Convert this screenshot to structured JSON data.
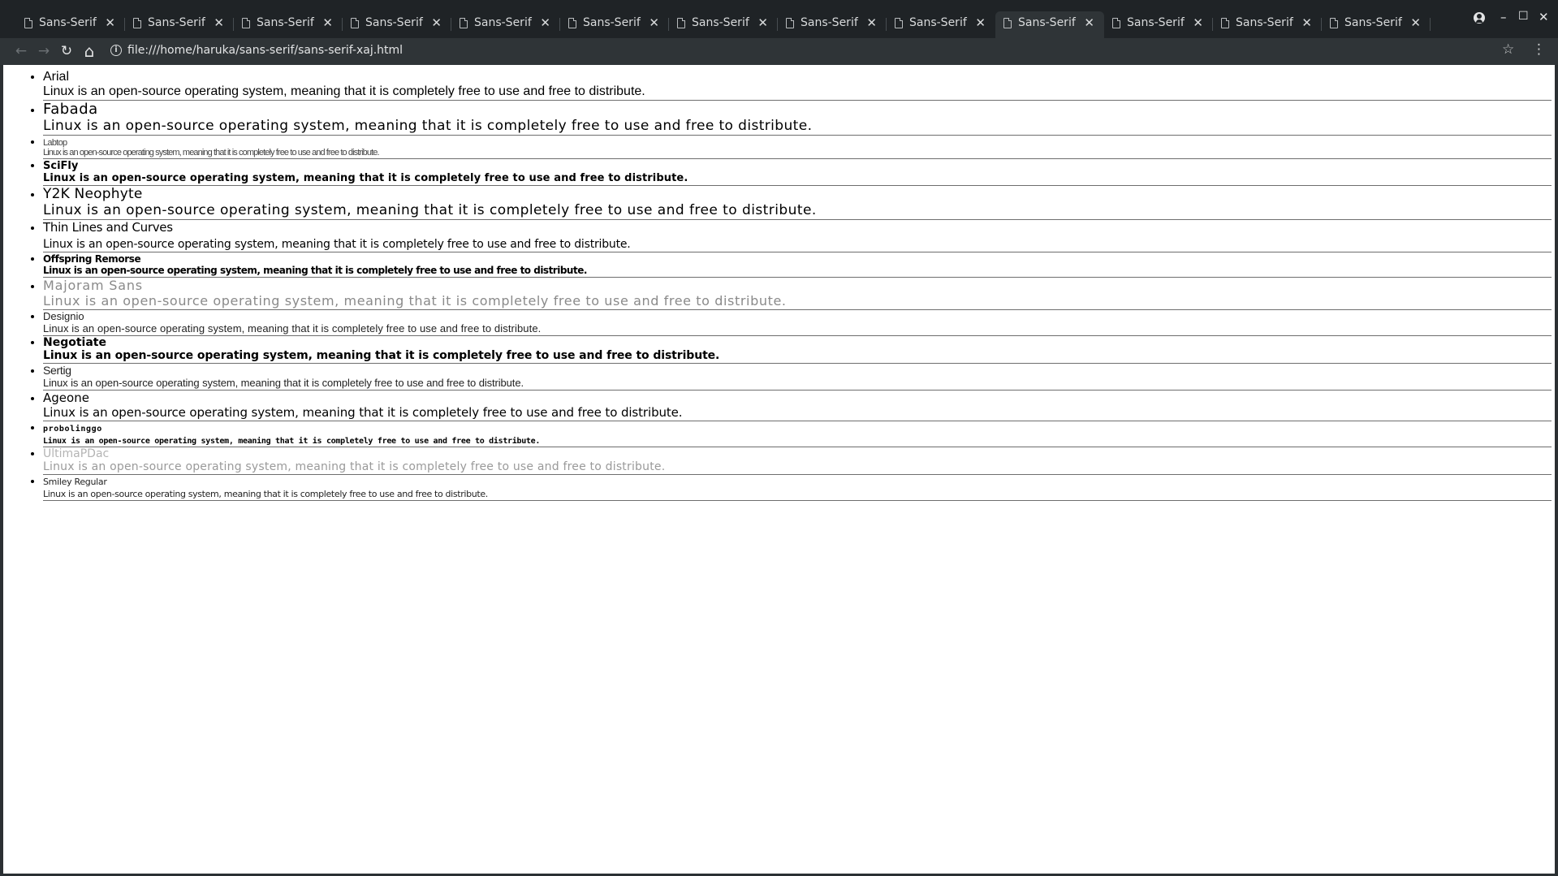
{
  "window": {
    "tab_title": "Sans-Serif",
    "tab_count": 13,
    "active_tab_index": 9,
    "url": "file:///home/haruka/sans-serif/sans-serif-xaj.html"
  },
  "controls": {
    "minimize": "–",
    "maximize": "☐",
    "close": "✕",
    "back": "←",
    "forward": "→",
    "reload": "↻",
    "home": "⌂",
    "star": "☆",
    "menu": "⋮"
  },
  "icons": {
    "tab_doc": "document-icon",
    "tab_close": "close-icon",
    "profile": "profile-icon",
    "info": "info-icon"
  },
  "sample_text": "Linux is an open-source operating system, meaning that it is completely free to use and free to distribute.",
  "fonts": [
    {
      "name": "Arial"
    },
    {
      "name": "Fabada"
    },
    {
      "name": "Labtop"
    },
    {
      "name": "SciFly"
    },
    {
      "name": "Y2K Neophyte"
    },
    {
      "name": "Thin Lines and Curves"
    },
    {
      "name": "Offspring Remorse"
    },
    {
      "name": "Majoram Sans"
    },
    {
      "name": "Designio"
    },
    {
      "name": "Negotiate"
    },
    {
      "name": "Sertig"
    },
    {
      "name": "Ageone"
    },
    {
      "name": "probolinggo"
    },
    {
      "name": "UltimaPDac"
    },
    {
      "name": "Smiley Regular"
    }
  ],
  "colors": {
    "tabstrip_bg": "#1f2326",
    "toolbar_bg": "#2f3437",
    "page_bg": "#ffffff",
    "text": "#000000",
    "row_divider": "#6e6e6e"
  }
}
